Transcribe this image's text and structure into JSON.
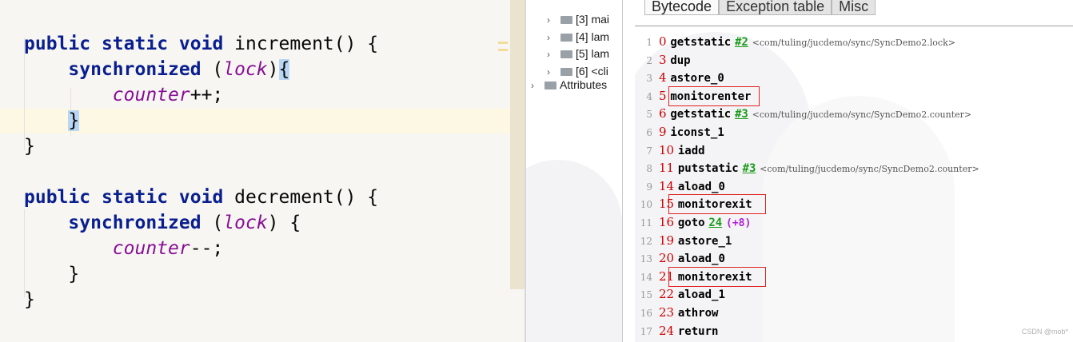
{
  "editor": {
    "lines": [
      {
        "tokens": [
          {
            "t": "public",
            "c": "kw"
          },
          {
            "t": " "
          },
          {
            "t": "static",
            "c": "kw"
          },
          {
            "t": " "
          },
          {
            "t": "void",
            "c": "kw"
          },
          {
            "t": " increment() {"
          }
        ]
      },
      {
        "tokens": [
          {
            "t": "    "
          },
          {
            "t": "synchronized",
            "c": "kw"
          },
          {
            "t": " ("
          },
          {
            "t": "lock",
            "c": "fld"
          },
          {
            "t": ")"
          },
          {
            "t": "{",
            "c": "bracket"
          }
        ]
      },
      {
        "tokens": [
          {
            "t": "        "
          },
          {
            "t": "counter",
            "c": "fld"
          },
          {
            "t": "++;"
          }
        ]
      },
      {
        "tokens": [
          {
            "t": "    "
          },
          {
            "t": "}",
            "c": "bracket"
          }
        ]
      },
      {
        "tokens": [
          {
            "t": "}"
          }
        ]
      },
      {
        "tokens": [
          {
            "t": ""
          }
        ]
      },
      {
        "tokens": [
          {
            "t": "public",
            "c": "kw"
          },
          {
            "t": " "
          },
          {
            "t": "static",
            "c": "kw"
          },
          {
            "t": " "
          },
          {
            "t": "void",
            "c": "kw"
          },
          {
            "t": " decrement() {"
          }
        ]
      },
      {
        "tokens": [
          {
            "t": "    "
          },
          {
            "t": "synchronized",
            "c": "kw"
          },
          {
            "t": " ("
          },
          {
            "t": "lock",
            "c": "fld"
          },
          {
            "t": ") {"
          }
        ]
      },
      {
        "tokens": [
          {
            "t": "        "
          },
          {
            "t": "counter",
            "c": "fld"
          },
          {
            "t": "--;"
          }
        ]
      },
      {
        "tokens": [
          {
            "t": "    }"
          }
        ]
      },
      {
        "tokens": [
          {
            "t": "}"
          }
        ]
      }
    ]
  },
  "tree": {
    "items": [
      {
        "label": "[3] mai",
        "folder": true
      },
      {
        "label": "[4] lam",
        "folder": true
      },
      {
        "label": "[5] lam",
        "folder": true
      },
      {
        "label": "[6] <cli",
        "folder": true
      },
      {
        "label": "Attributes",
        "folder": true
      }
    ]
  },
  "bytecode": {
    "tabs": [
      "Bytecode",
      "Exception table",
      "Misc"
    ],
    "rows": [
      {
        "ln": "1",
        "off": "0",
        "op": "getstatic",
        "ref": "#2",
        "cmt": "<com/tuling/jucdemo/sync/SyncDemo2.lock>"
      },
      {
        "ln": "2",
        "off": "3",
        "op": "dup"
      },
      {
        "ln": "3",
        "off": "4",
        "op": "astore_0"
      },
      {
        "ln": "4",
        "off": "5",
        "op": "monitorenter"
      },
      {
        "ln": "5",
        "off": "6",
        "op": "getstatic",
        "ref": "#3",
        "cmt": "<com/tuling/jucdemo/sync/SyncDemo2.counter>"
      },
      {
        "ln": "6",
        "off": "9",
        "op": "iconst_1"
      },
      {
        "ln": "7",
        "off": "10",
        "op": "iadd"
      },
      {
        "ln": "8",
        "off": "11",
        "op": "putstatic",
        "ref": "#3",
        "cmt": "<com/tuling/jucdemo/sync/SyncDemo2.counter>"
      },
      {
        "ln": "9",
        "off": "14",
        "op": "aload_0"
      },
      {
        "ln": "10",
        "off": "15",
        "op": "monitorexit"
      },
      {
        "ln": "11",
        "off": "16",
        "op": "goto",
        "ref": "24",
        "rel": "(+8)"
      },
      {
        "ln": "12",
        "off": "19",
        "op": "astore_1"
      },
      {
        "ln": "13",
        "off": "20",
        "op": "aload_0"
      },
      {
        "ln": "14",
        "off": "21",
        "op": "monitorexit"
      },
      {
        "ln": "15",
        "off": "22",
        "op": "aload_1"
      },
      {
        "ln": "16",
        "off": "23",
        "op": "athrow"
      },
      {
        "ln": "17",
        "off": "24",
        "op": "return"
      }
    ],
    "highlighted_offsets": [
      "5",
      "15",
      "21"
    ],
    "watermark": "CSDN @mob*"
  },
  "colors": {
    "keyword": "#0a1f8f",
    "field": "#871094",
    "offset": "#cc0000",
    "cp_ref": "#1a9b1a",
    "relative": "#b21bd8",
    "highlight_box": "#e02020"
  }
}
